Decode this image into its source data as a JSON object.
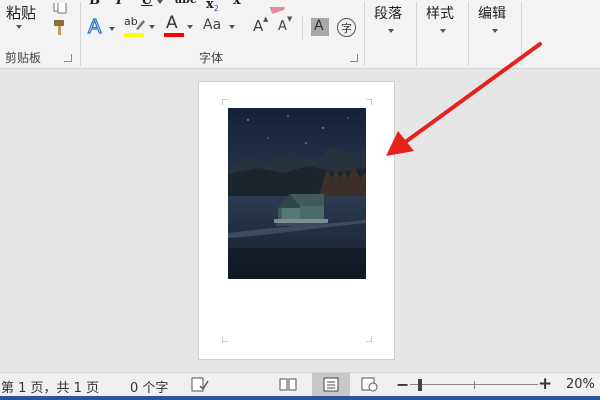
{
  "ribbon": {
    "clipboard": {
      "paste_label": "粘贴",
      "group_label": "剪贴板"
    },
    "font": {
      "bold": "B",
      "italic": "I",
      "underline": "U",
      "strikethrough": "abc",
      "subscript": "x",
      "subscript_sub": "2",
      "clear_format": "x",
      "highlight": "ab",
      "font_color": "A",
      "change_case": "Aa",
      "grow_font": "A",
      "shrink_font": "A",
      "char_shading": "A",
      "phonetic_char": "字",
      "group_label": "字体"
    },
    "paragraph_label": "段落",
    "styles_label": "样式",
    "editing_label": "编辑"
  },
  "status": {
    "page_info": "第 1 页，共 1 页",
    "word_count": "0 个字",
    "zoom_minus": "−",
    "zoom_plus": "+",
    "zoom_level": "20%"
  },
  "colors": {
    "highlight": "#ffff00",
    "font_color": "#ff0000",
    "arrow": "#e8201e",
    "accent": "#2b579a"
  }
}
